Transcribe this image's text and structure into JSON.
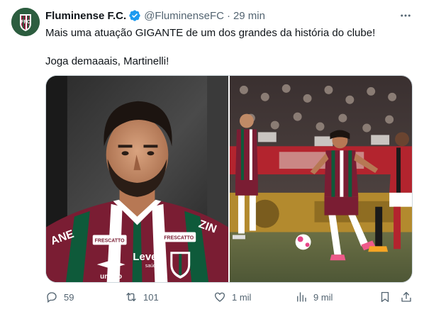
{
  "account": {
    "display_name": "Fluminense F.C.",
    "handle": "@FluminenseFC",
    "separator": "·",
    "time": "29 min",
    "verified_color": "#1d9bf0",
    "avatar_colors": [
      "#2c5d3f",
      "#8a1538",
      "#ffffff"
    ]
  },
  "tweet": {
    "line1": "Mais uma atuação GIGANTE de um dos grandes da história do clube!",
    "line2": "Joga demaaais, Martinelli!"
  },
  "media": {
    "photo1_sponsors": {
      "sponsor_left": "FRESCATTO",
      "sponsor_mid": "Leve",
      "sponsor_sub": "saúde",
      "sponsor_right": "FRESCATTO",
      "brand": "umbro",
      "shoulder_left": "ANE",
      "shoulder_right": "ZIN"
    },
    "kit_colors": [
      "#7a1d33",
      "#0e5a3a",
      "#ffffff"
    ]
  },
  "actions": {
    "replies": "59",
    "reposts": "101",
    "likes": "1 mil",
    "views": "9 mil"
  }
}
